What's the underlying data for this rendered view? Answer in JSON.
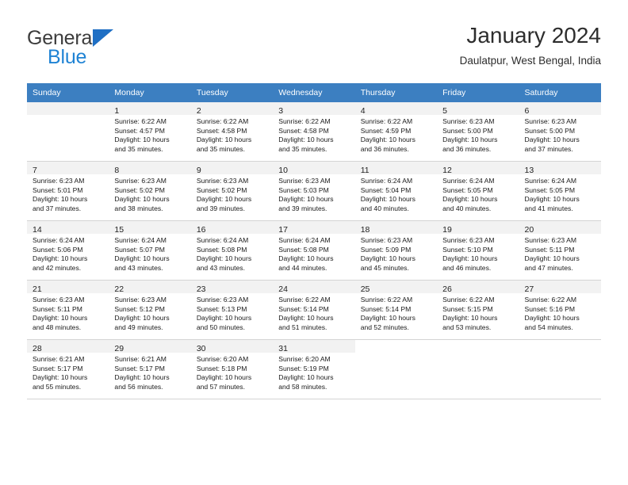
{
  "brand": {
    "name_top": "General",
    "name_bottom": "Blue",
    "triangle_color": "#1f6fc4",
    "blue_color": "#1f83d4"
  },
  "header": {
    "title": "January 2024",
    "subtitle": "Daulatpur, West Bengal, India"
  },
  "theme": {
    "header_band": "#3c7fc1",
    "daynum_bg": "#f2f2f2",
    "row_divider": "#d4d4d4"
  },
  "weekday_headers": [
    "Sunday",
    "Monday",
    "Tuesday",
    "Wednesday",
    "Thursday",
    "Friday",
    "Saturday"
  ],
  "weeks": [
    [
      {
        "day": "",
        "sunrise": "",
        "sunset": "",
        "daylight_line1": "",
        "daylight_line2": "",
        "empty": true
      },
      {
        "day": "1",
        "sunrise": "Sunrise: 6:22 AM",
        "sunset": "Sunset: 4:57 PM",
        "daylight_line1": "Daylight: 10 hours",
        "daylight_line2": "and 35 minutes."
      },
      {
        "day": "2",
        "sunrise": "Sunrise: 6:22 AM",
        "sunset": "Sunset: 4:58 PM",
        "daylight_line1": "Daylight: 10 hours",
        "daylight_line2": "and 35 minutes."
      },
      {
        "day": "3",
        "sunrise": "Sunrise: 6:22 AM",
        "sunset": "Sunset: 4:58 PM",
        "daylight_line1": "Daylight: 10 hours",
        "daylight_line2": "and 35 minutes."
      },
      {
        "day": "4",
        "sunrise": "Sunrise: 6:22 AM",
        "sunset": "Sunset: 4:59 PM",
        "daylight_line1": "Daylight: 10 hours",
        "daylight_line2": "and 36 minutes."
      },
      {
        "day": "5",
        "sunrise": "Sunrise: 6:23 AM",
        "sunset": "Sunset: 5:00 PM",
        "daylight_line1": "Daylight: 10 hours",
        "daylight_line2": "and 36 minutes."
      },
      {
        "day": "6",
        "sunrise": "Sunrise: 6:23 AM",
        "sunset": "Sunset: 5:00 PM",
        "daylight_line1": "Daylight: 10 hours",
        "daylight_line2": "and 37 minutes."
      }
    ],
    [
      {
        "day": "7",
        "sunrise": "Sunrise: 6:23 AM",
        "sunset": "Sunset: 5:01 PM",
        "daylight_line1": "Daylight: 10 hours",
        "daylight_line2": "and 37 minutes."
      },
      {
        "day": "8",
        "sunrise": "Sunrise: 6:23 AM",
        "sunset": "Sunset: 5:02 PM",
        "daylight_line1": "Daylight: 10 hours",
        "daylight_line2": "and 38 minutes."
      },
      {
        "day": "9",
        "sunrise": "Sunrise: 6:23 AM",
        "sunset": "Sunset: 5:02 PM",
        "daylight_line1": "Daylight: 10 hours",
        "daylight_line2": "and 39 minutes."
      },
      {
        "day": "10",
        "sunrise": "Sunrise: 6:23 AM",
        "sunset": "Sunset: 5:03 PM",
        "daylight_line1": "Daylight: 10 hours",
        "daylight_line2": "and 39 minutes."
      },
      {
        "day": "11",
        "sunrise": "Sunrise: 6:24 AM",
        "sunset": "Sunset: 5:04 PM",
        "daylight_line1": "Daylight: 10 hours",
        "daylight_line2": "and 40 minutes."
      },
      {
        "day": "12",
        "sunrise": "Sunrise: 6:24 AM",
        "sunset": "Sunset: 5:05 PM",
        "daylight_line1": "Daylight: 10 hours",
        "daylight_line2": "and 40 minutes."
      },
      {
        "day": "13",
        "sunrise": "Sunrise: 6:24 AM",
        "sunset": "Sunset: 5:05 PM",
        "daylight_line1": "Daylight: 10 hours",
        "daylight_line2": "and 41 minutes."
      }
    ],
    [
      {
        "day": "14",
        "sunrise": "Sunrise: 6:24 AM",
        "sunset": "Sunset: 5:06 PM",
        "daylight_line1": "Daylight: 10 hours",
        "daylight_line2": "and 42 minutes."
      },
      {
        "day": "15",
        "sunrise": "Sunrise: 6:24 AM",
        "sunset": "Sunset: 5:07 PM",
        "daylight_line1": "Daylight: 10 hours",
        "daylight_line2": "and 43 minutes."
      },
      {
        "day": "16",
        "sunrise": "Sunrise: 6:24 AM",
        "sunset": "Sunset: 5:08 PM",
        "daylight_line1": "Daylight: 10 hours",
        "daylight_line2": "and 43 minutes."
      },
      {
        "day": "17",
        "sunrise": "Sunrise: 6:24 AM",
        "sunset": "Sunset: 5:08 PM",
        "daylight_line1": "Daylight: 10 hours",
        "daylight_line2": "and 44 minutes."
      },
      {
        "day": "18",
        "sunrise": "Sunrise: 6:23 AM",
        "sunset": "Sunset: 5:09 PM",
        "daylight_line1": "Daylight: 10 hours",
        "daylight_line2": "and 45 minutes."
      },
      {
        "day": "19",
        "sunrise": "Sunrise: 6:23 AM",
        "sunset": "Sunset: 5:10 PM",
        "daylight_line1": "Daylight: 10 hours",
        "daylight_line2": "and 46 minutes."
      },
      {
        "day": "20",
        "sunrise": "Sunrise: 6:23 AM",
        "sunset": "Sunset: 5:11 PM",
        "daylight_line1": "Daylight: 10 hours",
        "daylight_line2": "and 47 minutes."
      }
    ],
    [
      {
        "day": "21",
        "sunrise": "Sunrise: 6:23 AM",
        "sunset": "Sunset: 5:11 PM",
        "daylight_line1": "Daylight: 10 hours",
        "daylight_line2": "and 48 minutes."
      },
      {
        "day": "22",
        "sunrise": "Sunrise: 6:23 AM",
        "sunset": "Sunset: 5:12 PM",
        "daylight_line1": "Daylight: 10 hours",
        "daylight_line2": "and 49 minutes."
      },
      {
        "day": "23",
        "sunrise": "Sunrise: 6:23 AM",
        "sunset": "Sunset: 5:13 PM",
        "daylight_line1": "Daylight: 10 hours",
        "daylight_line2": "and 50 minutes."
      },
      {
        "day": "24",
        "sunrise": "Sunrise: 6:22 AM",
        "sunset": "Sunset: 5:14 PM",
        "daylight_line1": "Daylight: 10 hours",
        "daylight_line2": "and 51 minutes."
      },
      {
        "day": "25",
        "sunrise": "Sunrise: 6:22 AM",
        "sunset": "Sunset: 5:14 PM",
        "daylight_line1": "Daylight: 10 hours",
        "daylight_line2": "and 52 minutes."
      },
      {
        "day": "26",
        "sunrise": "Sunrise: 6:22 AM",
        "sunset": "Sunset: 5:15 PM",
        "daylight_line1": "Daylight: 10 hours",
        "daylight_line2": "and 53 minutes."
      },
      {
        "day": "27",
        "sunrise": "Sunrise: 6:22 AM",
        "sunset": "Sunset: 5:16 PM",
        "daylight_line1": "Daylight: 10 hours",
        "daylight_line2": "and 54 minutes."
      }
    ],
    [
      {
        "day": "28",
        "sunrise": "Sunrise: 6:21 AM",
        "sunset": "Sunset: 5:17 PM",
        "daylight_line1": "Daylight: 10 hours",
        "daylight_line2": "and 55 minutes."
      },
      {
        "day": "29",
        "sunrise": "Sunrise: 6:21 AM",
        "sunset": "Sunset: 5:17 PM",
        "daylight_line1": "Daylight: 10 hours",
        "daylight_line2": "and 56 minutes."
      },
      {
        "day": "30",
        "sunrise": "Sunrise: 6:20 AM",
        "sunset": "Sunset: 5:18 PM",
        "daylight_line1": "Daylight: 10 hours",
        "daylight_line2": "and 57 minutes."
      },
      {
        "day": "31",
        "sunrise": "Sunrise: 6:20 AM",
        "sunset": "Sunset: 5:19 PM",
        "daylight_line1": "Daylight: 10 hours",
        "daylight_line2": "and 58 minutes."
      },
      {
        "day": "",
        "sunrise": "",
        "sunset": "",
        "daylight_line1": "",
        "daylight_line2": "",
        "blank": true
      },
      {
        "day": "",
        "sunrise": "",
        "sunset": "",
        "daylight_line1": "",
        "daylight_line2": "",
        "blank": true
      },
      {
        "day": "",
        "sunrise": "",
        "sunset": "",
        "daylight_line1": "",
        "daylight_line2": "",
        "blank": true
      }
    ]
  ]
}
